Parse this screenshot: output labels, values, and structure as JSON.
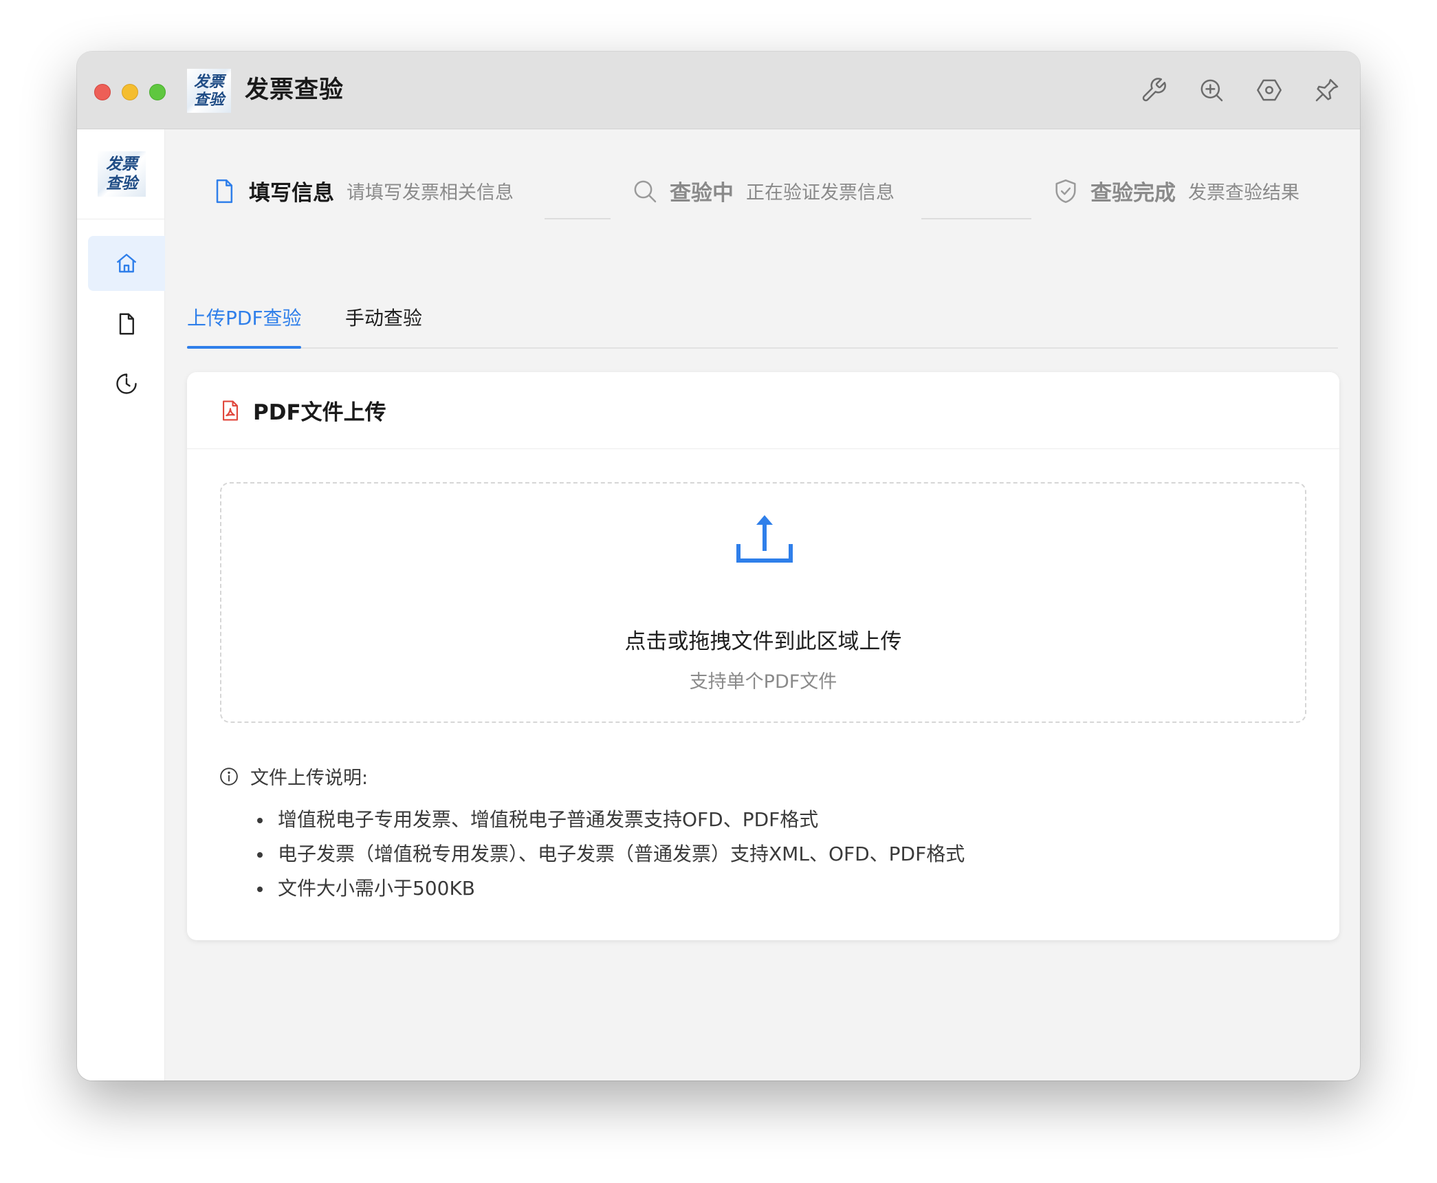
{
  "app": {
    "title": "发票查验",
    "logo_text_line1": "发票",
    "logo_text_line2": "查验"
  },
  "toolbar": {
    "icons": [
      "wrench-icon",
      "zoom-in-icon",
      "settings-hexagon-icon",
      "pin-icon"
    ]
  },
  "sidebar": {
    "items": [
      {
        "name": "home",
        "icon": "home-icon",
        "active": true
      },
      {
        "name": "document",
        "icon": "document-icon",
        "active": false
      },
      {
        "name": "history",
        "icon": "history-icon",
        "active": false
      }
    ],
    "menu_icon": "hamburger-menu-icon"
  },
  "steps": [
    {
      "title": "填写信息",
      "desc": "请填写发票相关信息",
      "icon": "document-icon",
      "state": "active"
    },
    {
      "title": "查验中",
      "desc": "正在验证发票信息",
      "icon": "search-icon",
      "state": "pending"
    },
    {
      "title": "查验完成",
      "desc": "发票查验结果",
      "icon": "shield-check-icon",
      "state": "pending"
    }
  ],
  "tabs": [
    {
      "label": "上传PDF查验",
      "active": true
    },
    {
      "label": "手动查验",
      "active": false
    }
  ],
  "upload_card": {
    "title": "PDF文件上传",
    "drop_main": "点击或拖拽文件到此区域上传",
    "drop_sub": "支持单个PDF文件",
    "notes_title": "文件上传说明:",
    "notes": [
      "增值税电子专用发票、增值税电子普通发票支持OFD、PDF格式",
      "电子发票（增值税专用发票）、电子发票（普通发票）支持XML、OFD、PDF格式",
      "文件大小需小于500KB"
    ]
  },
  "colors": {
    "accent": "#2f7fea",
    "pdf_red": "#e0463b",
    "titlebar": "#e1e1e1",
    "background": "#f3f3f3"
  }
}
